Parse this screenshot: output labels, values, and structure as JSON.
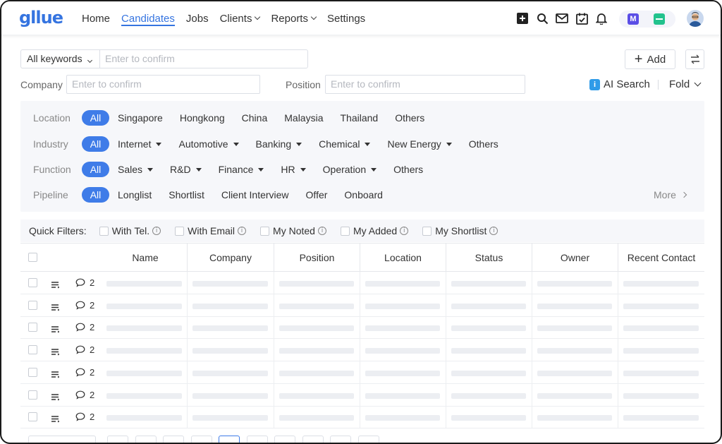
{
  "app": {
    "logo": "gllue"
  },
  "nav": {
    "items": [
      {
        "label": "Home",
        "active": false,
        "dropdown": false
      },
      {
        "label": "Candidates",
        "active": true,
        "dropdown": false
      },
      {
        "label": "Jobs",
        "active": false,
        "dropdown": false
      },
      {
        "label": "Clients",
        "active": false,
        "dropdown": true
      },
      {
        "label": "Reports",
        "active": false,
        "dropdown": true
      },
      {
        "label": "Settings",
        "active": false,
        "dropdown": false
      }
    ],
    "icons": [
      "add-square-icon",
      "search-icon",
      "mail-icon",
      "calendar-check-icon",
      "bell-icon"
    ],
    "apps": [
      "m-app-icon",
      "green-app-icon"
    ]
  },
  "search": {
    "keyword_select": "All keywords",
    "keyword_placeholder": "Enter to confirm",
    "add_label": "Add",
    "company_label": "Company",
    "company_placeholder": "Enter to confirm",
    "position_label": "Position",
    "position_placeholder": "Enter to confirm",
    "ai_search": "AI Search",
    "fold": "Fold"
  },
  "filters": {
    "all_label": "All",
    "location": {
      "label": "Location",
      "options": [
        "Singapore",
        "Hongkong",
        "China",
        "Malaysia",
        "Thailand",
        "Others"
      ]
    },
    "industry": {
      "label": "Industry",
      "options": [
        "Internet",
        "Automotive",
        "Banking",
        "Chemical",
        "New Energy",
        "Others"
      ]
    },
    "function": {
      "label": "Function",
      "options": [
        "Sales",
        "R&D",
        "Finance",
        "HR",
        "Operation",
        "Others"
      ]
    },
    "pipeline": {
      "label": "Pipeline",
      "options": [
        "Longlist",
        "Shortlist",
        "Client Interview",
        "Offer",
        "Onboard"
      ]
    },
    "more": "More"
  },
  "quick_filters": {
    "label": "Quick Filters:",
    "items": [
      "With Tel.",
      "With Email",
      "My Noted",
      "My Added",
      "My Shortlist"
    ]
  },
  "table": {
    "columns": [
      "Name",
      "Company",
      "Position",
      "Location",
      "Status",
      "Owner",
      "Recent Contact"
    ],
    "rows": [
      {
        "comments": "2"
      },
      {
        "comments": "2"
      },
      {
        "comments": "2"
      },
      {
        "comments": "2"
      },
      {
        "comments": "2"
      },
      {
        "comments": "2"
      },
      {
        "comments": "2"
      }
    ]
  },
  "colors": {
    "accent": "#3f7ce8",
    "panel": "#f6f7fa",
    "border": "#dcdfe6"
  }
}
